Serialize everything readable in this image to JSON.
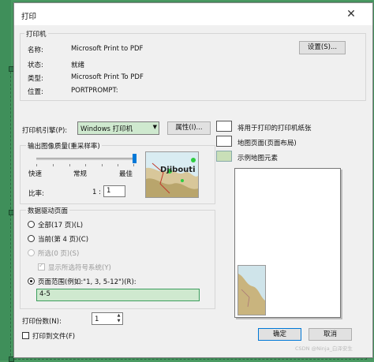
{
  "dialog": {
    "title": "打印",
    "close_glyph": "✕"
  },
  "printer": {
    "group_title": "打印机",
    "name_label": "名称:",
    "name_value": "Microsoft Print to PDF",
    "status_label": "状态:",
    "status_value": "就绪",
    "type_label": "类型:",
    "type_value": "Microsoft Print To PDF",
    "location_label": "位置:",
    "location_value": "PORTPROMPT:",
    "settings_button": "设置(S)..."
  },
  "engine": {
    "label": "打印机引擎(P):",
    "value": "Windows 打印机",
    "properties_button": "属性(I)..."
  },
  "quality": {
    "group_title": "输出图像质量(重采样率)",
    "slider_labels": [
      "快速",
      "常规",
      "最佳"
    ],
    "slider_level": 1.0,
    "ratio_label": "比率:",
    "ratio_prefix": "1 :",
    "ratio_value": "1",
    "preview_label": "Djibouti"
  },
  "pages": {
    "group_title": "数据驱动页面",
    "all_label": "全部(17 页)(L)",
    "current_label": "当前(第 4 页)(C)",
    "selected_label": "所选(0 页)(S)",
    "show_selected_label": "显示所选符号系统(Y)",
    "range_label": "页面范围(例如:\"1, 3, 5-12\")(R):",
    "range_value": "4-5",
    "selected_option": "range"
  },
  "copies": {
    "label": "打印份数(N):",
    "value": "1"
  },
  "print_to_file": {
    "label": "打印到文件(F)",
    "checked": false
  },
  "layout_options": {
    "use_printer_paper": "将用于打印的打印机纸张",
    "map_page": "地图页面(页面布局)",
    "sample_map_elements": "示例地图元素"
  },
  "buttons": {
    "ok": "确定",
    "cancel": "取消"
  },
  "watermark": "CSDN @Ninja_白泽安生"
}
